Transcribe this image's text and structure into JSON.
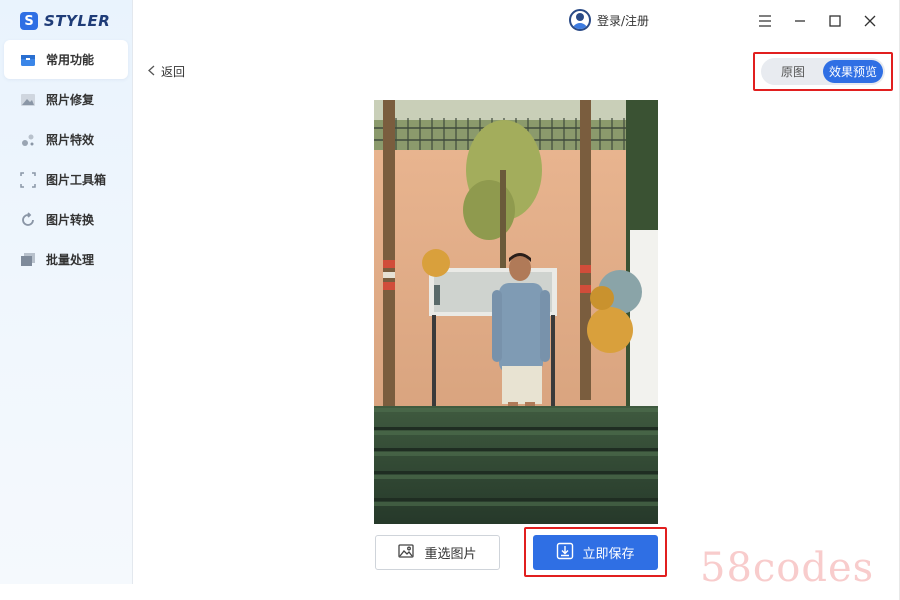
{
  "app": {
    "logo_text": "STYLER",
    "logo_mark": "S"
  },
  "sidebar": {
    "items": [
      {
        "label": "常用功能",
        "icon": "toolbox-icon",
        "active": true
      },
      {
        "label": "照片修复",
        "icon": "image-restore-icon",
        "active": false
      },
      {
        "label": "照片特效",
        "icon": "sparkle-effects-icon",
        "active": false
      },
      {
        "label": "图片工具箱",
        "icon": "crop-frame-icon",
        "active": false
      },
      {
        "label": "图片转换",
        "icon": "convert-refresh-icon",
        "active": false
      },
      {
        "label": "批量处理",
        "icon": "batch-stack-icon",
        "active": false
      }
    ]
  },
  "header": {
    "user_label": "登录/注册",
    "window_controls": [
      "menu-icon",
      "minimize-icon",
      "maximize-icon",
      "close-icon"
    ]
  },
  "main": {
    "back_label": "返回",
    "toggle": {
      "options": [
        "原图",
        "效果预览"
      ],
      "selected": "效果预览"
    },
    "reselect_label": "重选图片",
    "save_label": "立即保存"
  },
  "watermark": "58codes",
  "colors": {
    "accent": "#2f6fe4",
    "highlight_outline": "#e11f1f",
    "sidebar_bg": "#e9f3fd"
  }
}
